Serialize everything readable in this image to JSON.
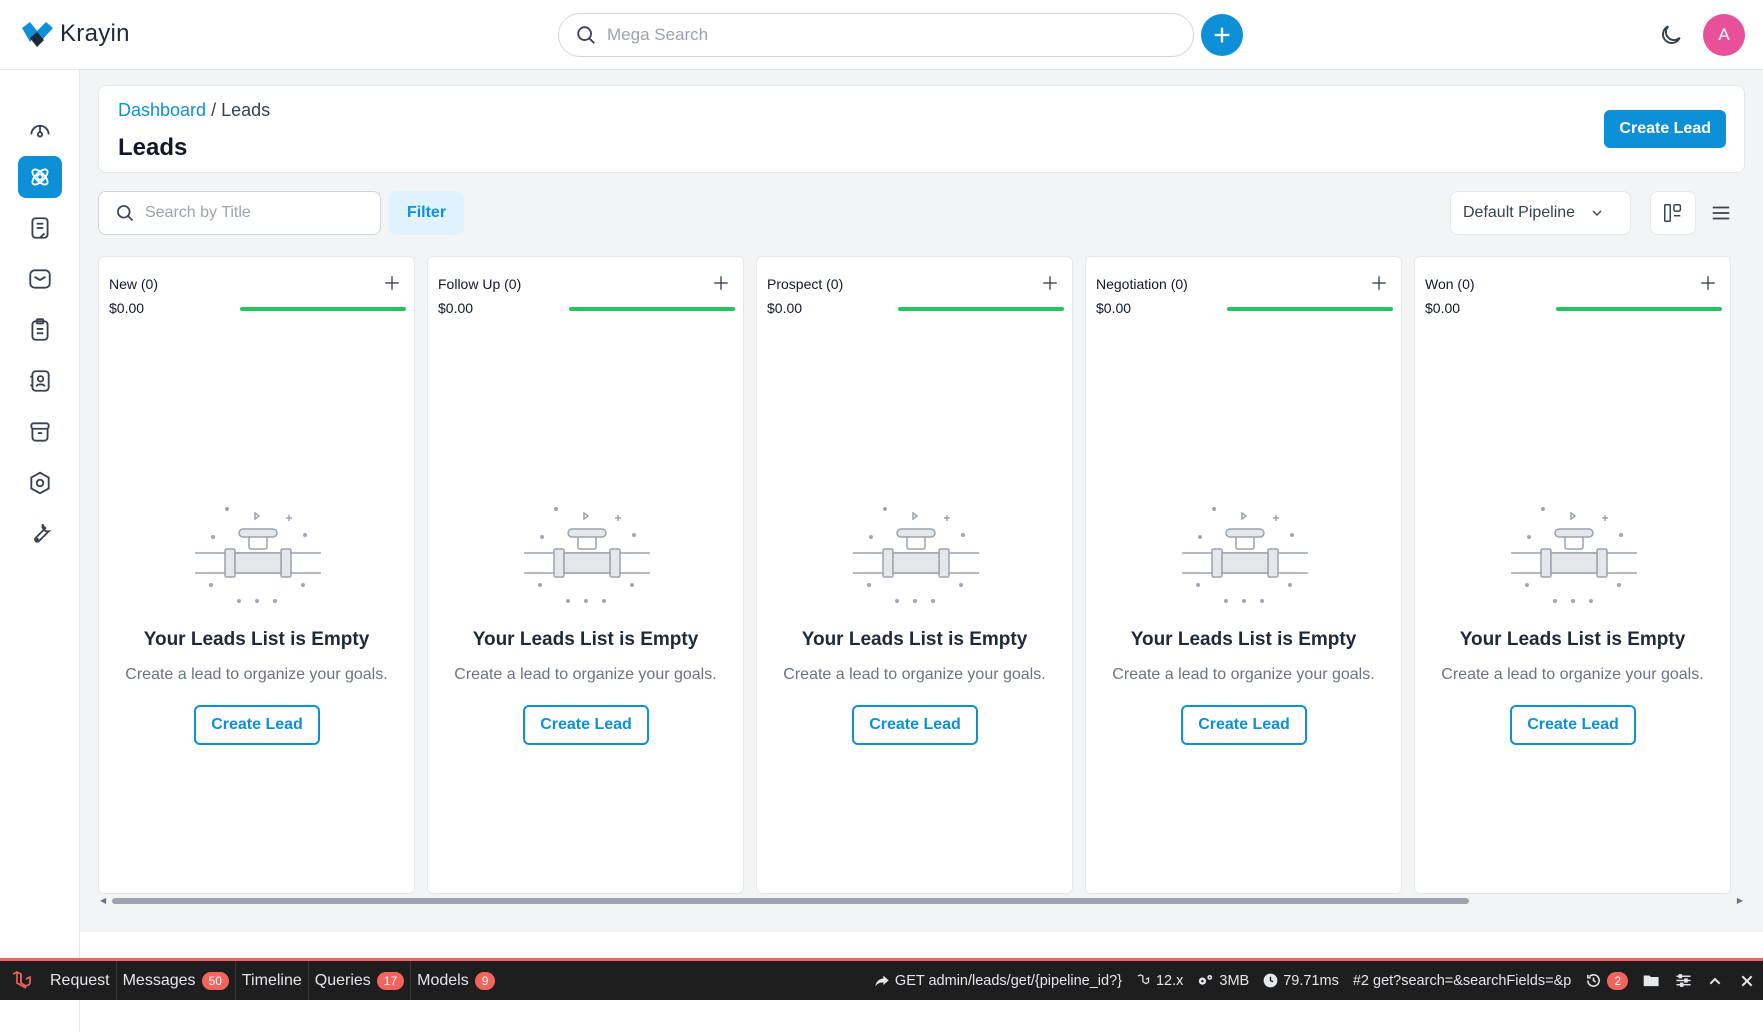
{
  "app": {
    "name": "Krayin"
  },
  "topbar": {
    "search_placeholder": "Mega Search",
    "avatar_initial": "A"
  },
  "sidebar": {
    "items": [
      {
        "name": "dashboard",
        "icon": "speedometer-icon",
        "active": false
      },
      {
        "name": "leads",
        "icon": "leads-icon",
        "active": true
      },
      {
        "name": "quotes",
        "icon": "quote-icon",
        "active": false
      },
      {
        "name": "mail",
        "icon": "mail-icon",
        "active": false
      },
      {
        "name": "activities",
        "icon": "clipboard-icon",
        "active": false
      },
      {
        "name": "contacts",
        "icon": "contact-icon",
        "active": false
      },
      {
        "name": "products",
        "icon": "box-icon",
        "active": false
      },
      {
        "name": "settings",
        "icon": "gear-icon",
        "active": false
      },
      {
        "name": "configuration",
        "icon": "wrench-icon",
        "active": false
      }
    ]
  },
  "header": {
    "breadcrumb_link": "Dashboard",
    "breadcrumb_sep": "/",
    "breadcrumb_current": "Leads",
    "title": "Leads",
    "create_label": "Create Lead"
  },
  "toolbar": {
    "search_placeholder": "Search by Title",
    "filter_label": "Filter",
    "pipeline_label": "Default Pipeline"
  },
  "stages": [
    {
      "name": "New (0)",
      "amount": "$0.00",
      "progress": 1.0
    },
    {
      "name": "Follow Up (0)",
      "amount": "$0.00",
      "progress": 1.0
    },
    {
      "name": "Prospect (0)",
      "amount": "$0.00",
      "progress": 1.0
    },
    {
      "name": "Negotiation (0)",
      "amount": "$0.00",
      "progress": 1.0
    },
    {
      "name": "Won (0)",
      "amount": "$0.00",
      "progress": 1.0
    }
  ],
  "empty_state": {
    "title": "Your Leads List is Empty",
    "description": "Create a lead to organize your goals.",
    "button_label": "Create Lead"
  },
  "debugbar": {
    "tabs": [
      {
        "label": "Request",
        "count": ""
      },
      {
        "label": "Messages",
        "count": "50"
      },
      {
        "label": "Timeline",
        "count": ""
      },
      {
        "label": "Queries",
        "count": "17"
      },
      {
        "label": "Models",
        "count": "9"
      }
    ],
    "route": "GET admin/leads/get/{pipeline_id?}",
    "version": "12.x",
    "memory": "3MB",
    "time": "79.71ms",
    "request": "#2 get?search=&searchFields=&p",
    "history_count": "2"
  },
  "colors": {
    "primary": "#0e90d9",
    "progress": "#22c55e",
    "avatar": "#e8519a",
    "debug_accent": "#f4645f"
  }
}
